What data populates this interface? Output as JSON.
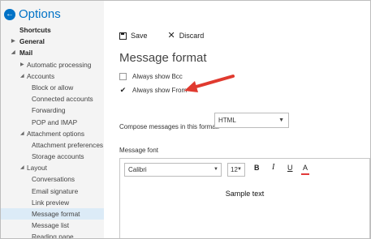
{
  "header": {
    "title": "Options",
    "back_icon": "back-arrow-icon"
  },
  "nav": {
    "items": [
      {
        "label": "Shortcuts",
        "bold": true,
        "indent": 0,
        "arrow": ""
      },
      {
        "label": "General",
        "bold": true,
        "indent": 0,
        "arrow": "collapsed"
      },
      {
        "label": "Mail",
        "bold": true,
        "indent": 0,
        "arrow": "expanded"
      },
      {
        "label": "Automatic processing",
        "bold": false,
        "indent": 1,
        "arrow": "collapsed"
      },
      {
        "label": "Accounts",
        "bold": false,
        "indent": 1,
        "arrow": "expanded"
      },
      {
        "label": "Block or allow",
        "bold": false,
        "indent": 2,
        "arrow": ""
      },
      {
        "label": "Connected accounts",
        "bold": false,
        "indent": 2,
        "arrow": ""
      },
      {
        "label": "Forwarding",
        "bold": false,
        "indent": 2,
        "arrow": ""
      },
      {
        "label": "POP and IMAP",
        "bold": false,
        "indent": 2,
        "arrow": ""
      },
      {
        "label": "Attachment options",
        "bold": false,
        "indent": 1,
        "arrow": "expanded"
      },
      {
        "label": "Attachment preferences",
        "bold": false,
        "indent": 2,
        "arrow": ""
      },
      {
        "label": "Storage accounts",
        "bold": false,
        "indent": 2,
        "arrow": ""
      },
      {
        "label": "Layout",
        "bold": false,
        "indent": 1,
        "arrow": "expanded"
      },
      {
        "label": "Conversations",
        "bold": false,
        "indent": 2,
        "arrow": ""
      },
      {
        "label": "Email signature",
        "bold": false,
        "indent": 2,
        "arrow": ""
      },
      {
        "label": "Link preview",
        "bold": false,
        "indent": 2,
        "arrow": ""
      },
      {
        "label": "Message format",
        "bold": false,
        "indent": 2,
        "arrow": "",
        "selected": true
      },
      {
        "label": "Message list",
        "bold": false,
        "indent": 2,
        "arrow": ""
      },
      {
        "label": "Reading pane",
        "bold": false,
        "indent": 2,
        "arrow": ""
      }
    ]
  },
  "toolbar": {
    "save_label": "Save",
    "discard_label": "Discard"
  },
  "main": {
    "title": "Message format",
    "always_show_bcc": {
      "label": "Always show Bcc",
      "checked": false
    },
    "always_show_from": {
      "label": "Always show From",
      "checked": true
    },
    "compose_label": "Compose messages in this format:",
    "compose_format": "HTML",
    "font_label": "Message font",
    "font_name": "Calibri",
    "font_size": "12",
    "format_buttons": {
      "bold": "B",
      "italic": "I",
      "underline": "U",
      "font_color": "A"
    },
    "sample_text": "Sample text"
  },
  "colors": {
    "accent": "#0072c6",
    "annotation_arrow": "#e03a2f",
    "selected_nav": "#dcebf7"
  }
}
